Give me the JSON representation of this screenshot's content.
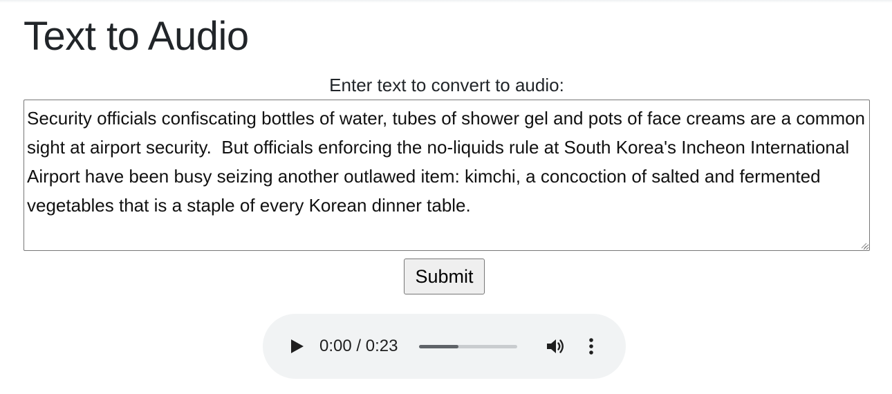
{
  "page": {
    "title": "Text to Audio",
    "prompt_label": "Enter text to convert to audio:"
  },
  "form": {
    "text_value": "Security officials confiscating bottles of water, tubes of shower gel and pots of face creams are a common sight at airport security.  But officials enforcing the no-liquids rule at South Korea's Incheon International Airport have been busy seizing another outlawed item: kimchi, a concoction of salted and fermented vegetables that is a staple of every Korean dinner table.",
    "submit_label": "Submit"
  },
  "audio_player": {
    "time_display": "0:00 / 0:23",
    "buffered_fraction": 0.4,
    "icons": {
      "play": "play-icon",
      "volume": "volume-icon",
      "menu": "more-options-icon"
    },
    "colors": {
      "background": "#f1f3f4",
      "track": "#c9cccf",
      "fill": "#5f6368"
    }
  }
}
